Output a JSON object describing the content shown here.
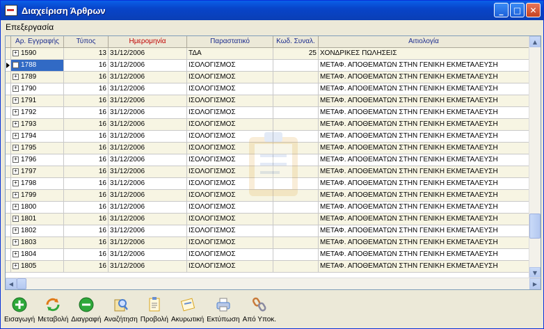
{
  "window": {
    "title": "Διαχείριση Άρθρων",
    "controls": [
      "minimize-icon",
      "maximize-icon",
      "close-icon"
    ]
  },
  "menu": {
    "items": [
      "Επεξεργασία"
    ]
  },
  "grid": {
    "columns": [
      "Αρ. Εγγραφής",
      "Τύπος",
      "Ημερομηνία",
      "Παραστατικό",
      "Κωδ. Συναλ.",
      "Αιτιολογία"
    ],
    "selected_row": 1,
    "rows": [
      {
        "id": "1590",
        "type": "13",
        "date": "31/12/2006",
        "doc": "ΤΔΑ",
        "code": "25",
        "desc": "ΧΟΝΔΡΙΚΕΣ ΠΩΛΗΣΕΙΣ"
      },
      {
        "id": "1788",
        "type": "16",
        "date": "31/12/2006",
        "doc": "ΙΣΟΛΟΓΙΣΜΟΣ",
        "code": "",
        "desc": "ΜΕΤΑΦ. ΑΠΟΘΕΜΑΤΩΝ ΣΤΗΝ ΓΕΝΙΚΗ ΕΚΜΕΤΑΛΕΥΣΗ"
      },
      {
        "id": "1789",
        "type": "16",
        "date": "31/12/2006",
        "doc": "ΙΣΟΛΟΓΙΣΜΟΣ",
        "code": "",
        "desc": "ΜΕΤΑΦ. ΑΠΟΘΕΜΑΤΩΝ ΣΤΗΝ ΓΕΝΙΚΗ ΕΚΜΕΤΑΛΕΥΣΗ"
      },
      {
        "id": "1790",
        "type": "16",
        "date": "31/12/2006",
        "doc": "ΙΣΟΛΟΓΙΣΜΟΣ",
        "code": "",
        "desc": "ΜΕΤΑΦ. ΑΠΟΘΕΜΑΤΩΝ ΣΤΗΝ ΓΕΝΙΚΗ ΕΚΜΕΤΑΛΕΥΣΗ"
      },
      {
        "id": "1791",
        "type": "16",
        "date": "31/12/2006",
        "doc": "ΙΣΟΛΟΓΙΣΜΟΣ",
        "code": "",
        "desc": "ΜΕΤΑΦ. ΑΠΟΘΕΜΑΤΩΝ ΣΤΗΝ ΓΕΝΙΚΗ ΕΚΜΕΤΑΛΕΥΣΗ"
      },
      {
        "id": "1792",
        "type": "16",
        "date": "31/12/2006",
        "doc": "ΙΣΟΛΟΓΙΣΜΟΣ",
        "code": "",
        "desc": "ΜΕΤΑΦ. ΑΠΟΘΕΜΑΤΩΝ ΣΤΗΝ ΓΕΝΙΚΗ ΕΚΜΕΤΑΛΕΥΣΗ"
      },
      {
        "id": "1793",
        "type": "16",
        "date": "31/12/2006",
        "doc": "ΙΣΟΛΟΓΙΣΜΟΣ",
        "code": "",
        "desc": "ΜΕΤΑΦ. ΑΠΟΘΕΜΑΤΩΝ ΣΤΗΝ ΓΕΝΙΚΗ ΕΚΜΕΤΑΛΕΥΣΗ"
      },
      {
        "id": "1794",
        "type": "16",
        "date": "31/12/2006",
        "doc": "ΙΣΟΛΟΓΙΣΜΟΣ",
        "code": "",
        "desc": "ΜΕΤΑΦ. ΑΠΟΘΕΜΑΤΩΝ ΣΤΗΝ ΓΕΝΙΚΗ ΕΚΜΕΤΑΛΕΥΣΗ"
      },
      {
        "id": "1795",
        "type": "16",
        "date": "31/12/2006",
        "doc": "ΙΣΟΛΟΓΙΣΜΟΣ",
        "code": "",
        "desc": "ΜΕΤΑΦ. ΑΠΟΘΕΜΑΤΩΝ ΣΤΗΝ ΓΕΝΙΚΗ ΕΚΜΕΤΑΛΕΥΣΗ"
      },
      {
        "id": "1796",
        "type": "16",
        "date": "31/12/2006",
        "doc": "ΙΣΟΛΟΓΙΣΜΟΣ",
        "code": "",
        "desc": "ΜΕΤΑΦ. ΑΠΟΘΕΜΑΤΩΝ ΣΤΗΝ ΓΕΝΙΚΗ ΕΚΜΕΤΑΛΕΥΣΗ"
      },
      {
        "id": "1797",
        "type": "16",
        "date": "31/12/2006",
        "doc": "ΙΣΟΛΟΓΙΣΜΟΣ",
        "code": "",
        "desc": "ΜΕΤΑΦ. ΑΠΟΘΕΜΑΤΩΝ ΣΤΗΝ ΓΕΝΙΚΗ ΕΚΜΕΤΑΛΕΥΣΗ"
      },
      {
        "id": "1798",
        "type": "16",
        "date": "31/12/2006",
        "doc": "ΙΣΟΛΟΓΙΣΜΟΣ",
        "code": "",
        "desc": "ΜΕΤΑΦ. ΑΠΟΘΕΜΑΤΩΝ ΣΤΗΝ ΓΕΝΙΚΗ ΕΚΜΕΤΑΛΕΥΣΗ"
      },
      {
        "id": "1799",
        "type": "16",
        "date": "31/12/2006",
        "doc": "ΙΣΟΛΟΓΙΣΜΟΣ",
        "code": "",
        "desc": "ΜΕΤΑΦ. ΑΠΟΘΕΜΑΤΩΝ ΣΤΗΝ ΓΕΝΙΚΗ ΕΚΜΕΤΑΛΕΥΣΗ"
      },
      {
        "id": "1800",
        "type": "16",
        "date": "31/12/2006",
        "doc": "ΙΣΟΛΟΓΙΣΜΟΣ",
        "code": "",
        "desc": "ΜΕΤΑΦ. ΑΠΟΘΕΜΑΤΩΝ ΣΤΗΝ ΓΕΝΙΚΗ ΕΚΜΕΤΑΛΕΥΣΗ"
      },
      {
        "id": "1801",
        "type": "16",
        "date": "31/12/2006",
        "doc": "ΙΣΟΛΟΓΙΣΜΟΣ",
        "code": "",
        "desc": "ΜΕΤΑΦ. ΑΠΟΘΕΜΑΤΩΝ ΣΤΗΝ ΓΕΝΙΚΗ ΕΚΜΕΤΑΛΕΥΣΗ"
      },
      {
        "id": "1802",
        "type": "16",
        "date": "31/12/2006",
        "doc": "ΙΣΟΛΟΓΙΣΜΟΣ",
        "code": "",
        "desc": "ΜΕΤΑΦ. ΑΠΟΘΕΜΑΤΩΝ ΣΤΗΝ ΓΕΝΙΚΗ ΕΚΜΕΤΑΛΕΥΣΗ"
      },
      {
        "id": "1803",
        "type": "16",
        "date": "31/12/2006",
        "doc": "ΙΣΟΛΟΓΙΣΜΟΣ",
        "code": "",
        "desc": "ΜΕΤΑΦ. ΑΠΟΘΕΜΑΤΩΝ ΣΤΗΝ ΓΕΝΙΚΗ ΕΚΜΕΤΑΛΕΥΣΗ"
      },
      {
        "id": "1804",
        "type": "16",
        "date": "31/12/2006",
        "doc": "ΙΣΟΛΟΓΙΣΜΟΣ",
        "code": "",
        "desc": "ΜΕΤΑΦ. ΑΠΟΘΕΜΑΤΩΝ ΣΤΗΝ ΓΕΝΙΚΗ ΕΚΜΕΤΑΛΕΥΣΗ"
      },
      {
        "id": "1805",
        "type": "16",
        "date": "31/12/2006",
        "doc": "ΙΣΟΛΟΓΙΣΜΟΣ",
        "code": "",
        "desc": "ΜΕΤΑΦ. ΑΠΟΘΕΜΑΤΩΝ ΣΤΗΝ ΓΕΝΙΚΗ ΕΚΜΕΤΑΛΕΥΣΗ"
      }
    ]
  },
  "toolbar": {
    "buttons": [
      {
        "label": "Εισαγωγή",
        "icon": "add-icon",
        "color": "#2ea83a"
      },
      {
        "label": "Μεταβολή",
        "icon": "refresh-icon",
        "color": "#e07a18"
      },
      {
        "label": "Διαγραφή",
        "icon": "remove-icon",
        "color": "#2ea83a"
      },
      {
        "label": "Αναζήτηση",
        "icon": "search-icon",
        "color": "#4a7fd0"
      },
      {
        "label": "Προβολή",
        "icon": "view-icon",
        "color": "#d9a520"
      },
      {
        "label": "Ακυρωτική",
        "icon": "cancel-doc-icon",
        "color": "#d9a520"
      },
      {
        "label": "Εκτύπωση",
        "icon": "print-icon",
        "color": "#4a7fd0"
      },
      {
        "label": "Από Υποκ.",
        "icon": "link-icon",
        "color": "#c87a3a"
      }
    ]
  }
}
